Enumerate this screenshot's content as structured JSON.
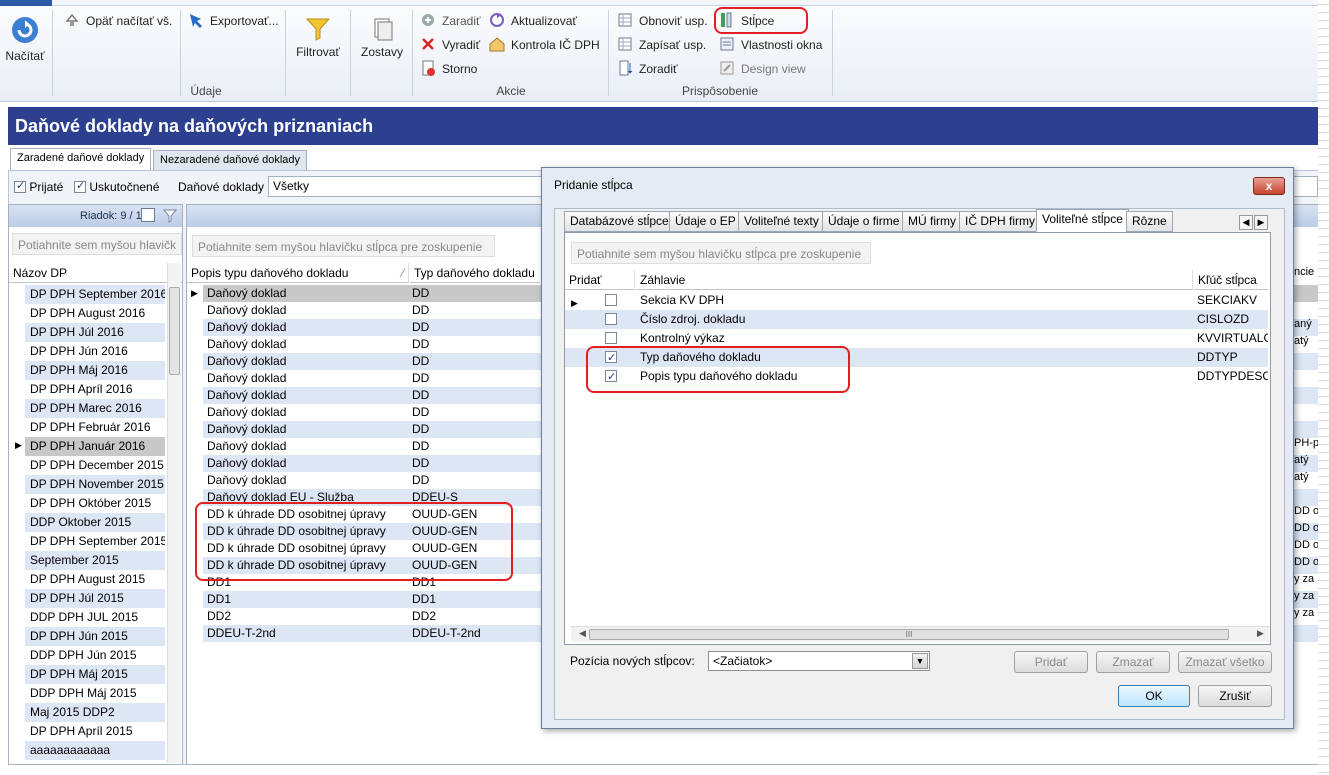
{
  "ribbon": {
    "refresh_label": "Načítať",
    "reload_all_label": "Opäť načítať vš.",
    "export_label": "Exportovať...",
    "filter_label": "Filtrovať",
    "reports_label": "Zostavy",
    "group_data": "Údaje",
    "file_label": "Zaradiť",
    "update_label": "Aktualizovať",
    "exclude_label": "Vyradiť",
    "check_ic_dph_label": "Kontrola IČ DPH",
    "storno_label": "Storno",
    "group_actions": "Akcie",
    "restore_settings_label": "Obnoviť usp.",
    "columns_label": "Stĺpce",
    "save_settings_label": "Zapísať usp.",
    "window_props_label": "Vlastnosti okna",
    "sort_label": "Zoradiť",
    "design_view_label": "Design view",
    "group_customize": "Prispôsobenie"
  },
  "page": {
    "title": "Daňové doklady na daňových priznaniach",
    "tabs": [
      "Zaradené daňové doklady",
      "Nezaradené daňové doklady"
    ]
  },
  "filter": {
    "received_label": "Prijaté",
    "realized_label": "Uskutočnené",
    "docs_label": "Daňové doklady",
    "docs_value": "Všetky"
  },
  "left": {
    "rows_label": "Riadok: 9 / 168",
    "group_hint": "Potiahnite sem myšou hlavičk",
    "column_header": "Názov DP",
    "items": [
      "DP DPH September 2016",
      "DP DPH August 2016",
      "DP DPH Júl 2016",
      "DP DPH Jún 2016",
      "DP DPH Máj 2016",
      "DP DPH Apríl 2016",
      "DP DPH Marec 2016",
      "DP DPH Február 2016",
      "DP DPH Január 2016",
      "DP DPH December 2015",
      "DP DPH November 2015",
      "DP DPH Október 2015",
      "DDP Oktober 2015",
      "DP DPH September 2015",
      "September 2015",
      "DP DPH August 2015",
      "DP DPH Júl 2015",
      "DDP DPH JUL 2015",
      "DP DPH Jún 2015",
      "DDP DPH Jún 2015",
      "DP DPH Máj 2015",
      "DDP DPH Máj 2015",
      "Maj 2015 DDP2",
      "DP DPH Apríl 2015",
      "aaaaaaaaaaaa"
    ]
  },
  "main": {
    "group_hint": "Potiahnite sem myšou hlavičku stĺpca pre zoskupenie",
    "col_desc": "Popis typu daňového dokladu",
    "col_type": "Typ daňového dokladu",
    "rows": [
      {
        "desc": "Daňový doklad",
        "type": "DD"
      },
      {
        "desc": "Daňový doklad",
        "type": "DD"
      },
      {
        "desc": "Daňový doklad",
        "type": "DD"
      },
      {
        "desc": "Daňový doklad",
        "type": "DD"
      },
      {
        "desc": "Daňový doklad",
        "type": "DD"
      },
      {
        "desc": "Daňový doklad",
        "type": "DD"
      },
      {
        "desc": "Daňový doklad",
        "type": "DD"
      },
      {
        "desc": "Daňový doklad",
        "type": "DD"
      },
      {
        "desc": "Daňový doklad",
        "type": "DD"
      },
      {
        "desc": "Daňový doklad",
        "type": "DD"
      },
      {
        "desc": "Daňový doklad",
        "type": "DD"
      },
      {
        "desc": "Daňový doklad",
        "type": "DD"
      },
      {
        "desc": "Daňový doklad EU - Služba",
        "type": "DDEU-S"
      },
      {
        "desc": "DD k úhrade DD osobitnej úpravy",
        "type": "OUUD-GEN"
      },
      {
        "desc": "DD k úhrade DD osobitnej úpravy",
        "type": "OUUD-GEN"
      },
      {
        "desc": "DD k úhrade DD osobitnej úpravy",
        "type": "OUUD-GEN"
      },
      {
        "desc": "DD k úhrade DD osobitnej úpravy",
        "type": "OUUD-GEN"
      },
      {
        "desc": "DD1",
        "type": "DD1"
      },
      {
        "desc": "DD1",
        "type": "DD1"
      },
      {
        "desc": "DD2",
        "type": "DD2"
      },
      {
        "desc": "DDEU-T-2nd",
        "type": "DDEU-T-2nd"
      }
    ],
    "right_fragments": [
      {
        "row": 1,
        "text": "ncie"
      },
      {
        "row": 3,
        "text": "aný"
      },
      {
        "row": 4,
        "text": "atý"
      },
      {
        "row": 10,
        "text": "PH-p"
      },
      {
        "row": 11,
        "text": "atý"
      },
      {
        "row": 12,
        "text": "atý"
      },
      {
        "row": 14,
        "text": "DD o"
      },
      {
        "row": 15,
        "text": "DD o"
      },
      {
        "row": 16,
        "text": "DD o"
      },
      {
        "row": 17,
        "text": "DD o"
      },
      {
        "row": 18,
        "text": "y za"
      },
      {
        "row": 19,
        "text": "y za"
      },
      {
        "row": 20,
        "text": "y za"
      }
    ]
  },
  "dialog": {
    "title": "Pridanie stĺpca",
    "close_label": "x",
    "tabs": [
      "Databázové stĺpce",
      "Údaje o EP",
      "Voliteľné texty",
      "Údaje o firme",
      "MÚ firmy",
      "IČ DPH firmy",
      "Voliteľné stĺpce",
      "Rôzne"
    ],
    "active_tab": "Voliteľné stĺpce",
    "group_hint": "Potiahnite sem myšou hlavičku stĺpca pre zoskupenie",
    "col_add": "Pridať",
    "col_header": "Záhlavie",
    "col_key": "Kľúč stĺpca",
    "rows": [
      {
        "checked": false,
        "header": "Sekcia KV DPH",
        "key": "SEKCIAKV"
      },
      {
        "checked": false,
        "header": "Číslo zdroj. dokladu",
        "key": "CISLOZD"
      },
      {
        "checked": false,
        "header": "Kontrolný výkaz",
        "key": "KVVIRTUALC"
      },
      {
        "checked": true,
        "header": "Typ daňového dokladu",
        "key": "DDTYP"
      },
      {
        "checked": true,
        "header": "Popis typu daňového dokladu",
        "key": "DDTYPDESC"
      }
    ],
    "scroll_mid": "III",
    "position_label": "Pozícia nových stĺpcov:",
    "position_value": "<Začiatok>",
    "add_button": "Pridať",
    "delete_button": "Zmazať",
    "delete_all_button": "Zmazať všetko",
    "ok_button": "OK",
    "cancel_button": "Zrušiť"
  },
  "colors": {
    "title_bar": "#2d3f8f",
    "highlight": "#e02020",
    "row_alt": "#dce6f4"
  }
}
